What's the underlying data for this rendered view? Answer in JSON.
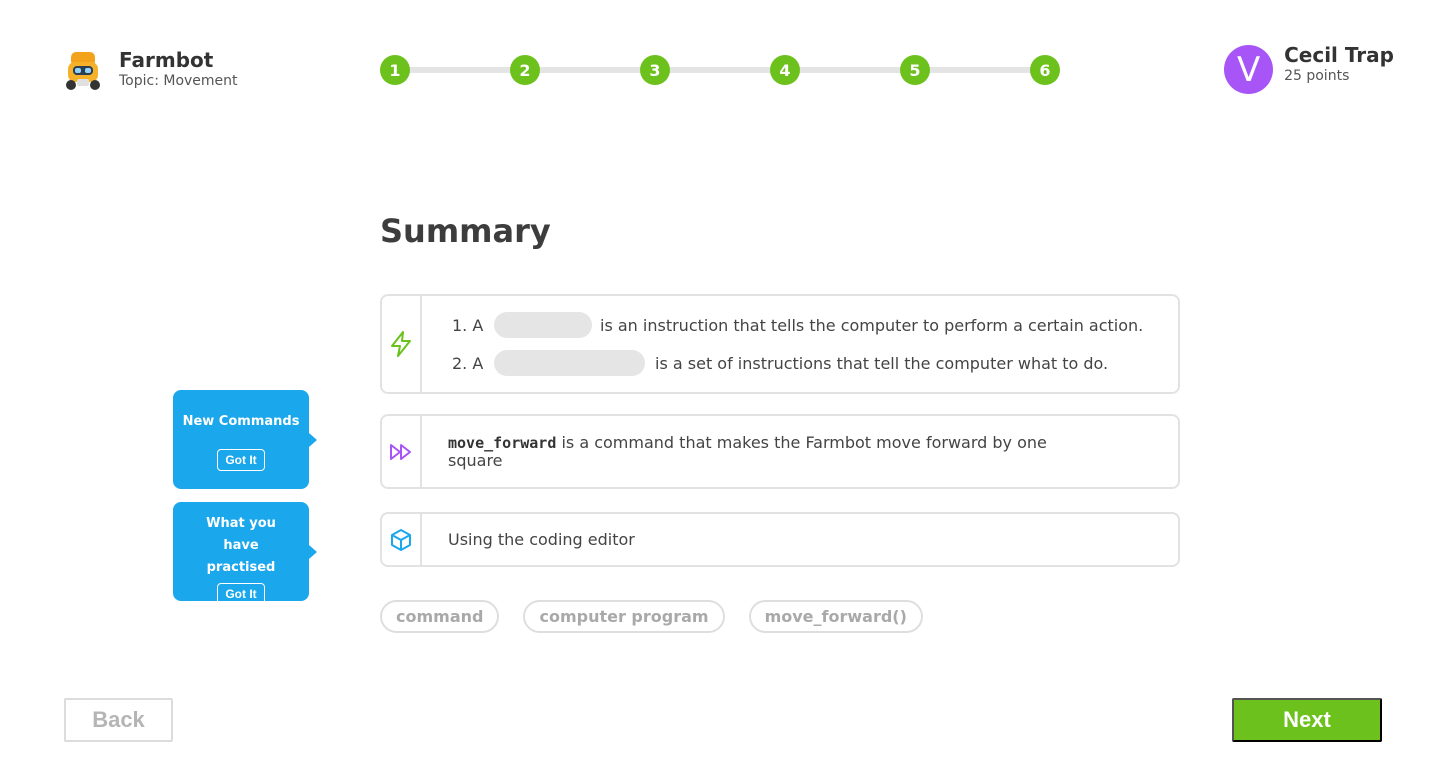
{
  "app": {
    "title": "Farmbot",
    "topic": "Topic: Movement",
    "logo_icon": "farmbot-robot-icon"
  },
  "progress": {
    "steps": [
      "1",
      "2",
      "3",
      "4",
      "5",
      "6"
    ],
    "current": 6,
    "color": "#6cc11c"
  },
  "user": {
    "initial": "V",
    "name": "Cecil Trap",
    "points": "25 points",
    "avatar_color": "#a855f7"
  },
  "summary": {
    "title": "Summary",
    "card1": {
      "icon": "lightning-icon",
      "line1": {
        "num": "1. A",
        "text": "is an instruction that tells the computer to perform a certain action."
      },
      "line2": {
        "num": "2. A",
        "text": "is a set of instructions that tell the computer what to do."
      }
    },
    "card2": {
      "icon": "fast-forward-icon",
      "code": "move_forward",
      "text": " is a command that makes the Farmbot move forward by one square"
    },
    "card3": {
      "icon": "cube-icon",
      "text": "Using the coding editor"
    }
  },
  "chips": [
    "command",
    "computer program",
    "move_forward()"
  ],
  "tips": [
    {
      "label": "New Commands",
      "button": "Got It"
    },
    {
      "label": "What you have practised",
      "button": "Got It"
    }
  ],
  "nav": {
    "back": "Back",
    "next": "Next"
  }
}
